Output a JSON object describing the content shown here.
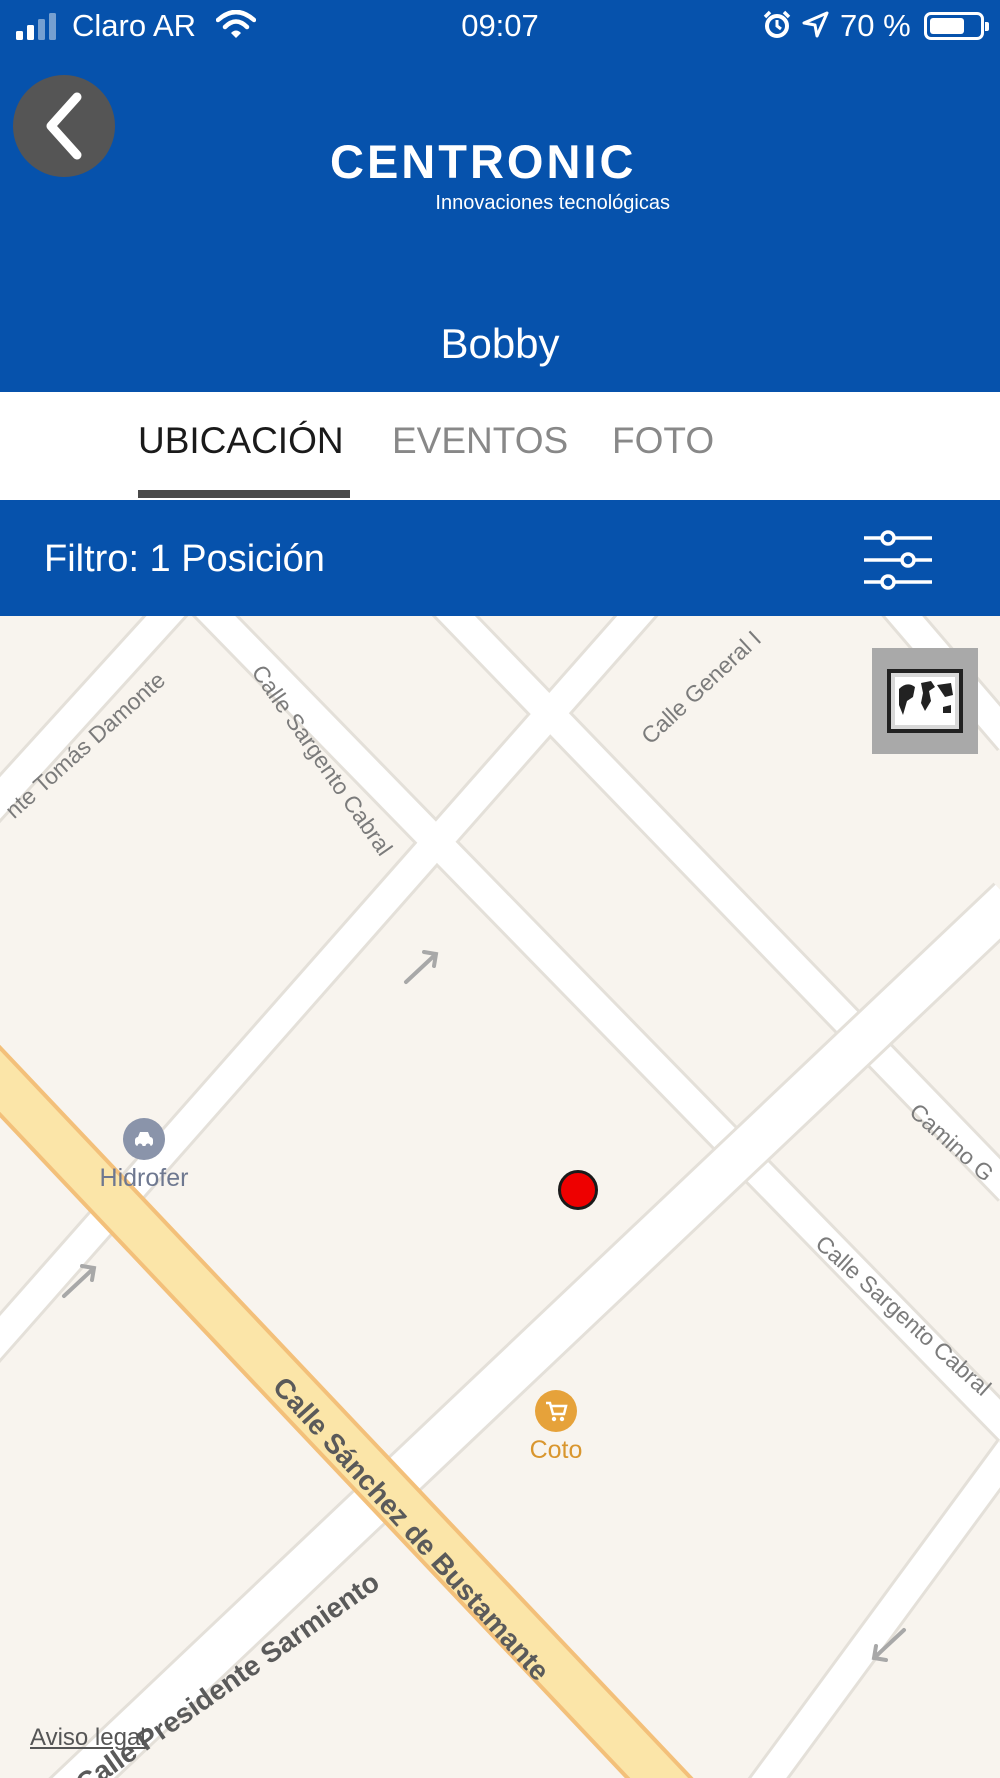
{
  "status_bar": {
    "carrier": "Claro AR",
    "time": "09:07",
    "battery_percent": "70 %",
    "battery_level": 0.7,
    "icons": [
      "signal-icon",
      "wifi-icon",
      "alarm-icon",
      "location-arrow-icon",
      "battery-icon"
    ]
  },
  "header": {
    "back_icon": "chevron-left-icon",
    "logo_brand": "CENTRONIC",
    "logo_tagline": "Innovaciones tecnológicas",
    "device_name": "Bobby"
  },
  "tabs": [
    {
      "label": "UBICACIÓN",
      "active": true
    },
    {
      "label": "EVENTOS",
      "active": false
    },
    {
      "label": "FOTO",
      "active": false
    }
  ],
  "filter": {
    "label": "Filtro: 1 Posición",
    "icon": "sliders-icon"
  },
  "map": {
    "map_type_icon": "world-map-icon",
    "streets": {
      "tomas_damonte": "nte Tomás Damonte",
      "sargento_cabral_top": "Calle Sargento Cabral",
      "general": "Calle General I",
      "camino": "Camino G",
      "sargento_cabral_right": "Calle Sargento Cabral",
      "sanchez_bustamante": "Calle Sánchez de Bustamante",
      "presidente_sarmiento": "Calle Presidente Sarmiento"
    },
    "pois": {
      "hidrofer": {
        "label": "Hidrofer",
        "icon": "car-wash-icon",
        "color": "#8a94aa"
      },
      "coto": {
        "label": "Coto",
        "icon": "shopping-cart-icon",
        "color": "#e6a23a"
      }
    },
    "marker_color": "#ee0000",
    "legal": "Aviso legal"
  },
  "colors": {
    "primary": "#0652ac",
    "map_background": "#f8f4ee",
    "major_road": "#fbe5a8"
  }
}
